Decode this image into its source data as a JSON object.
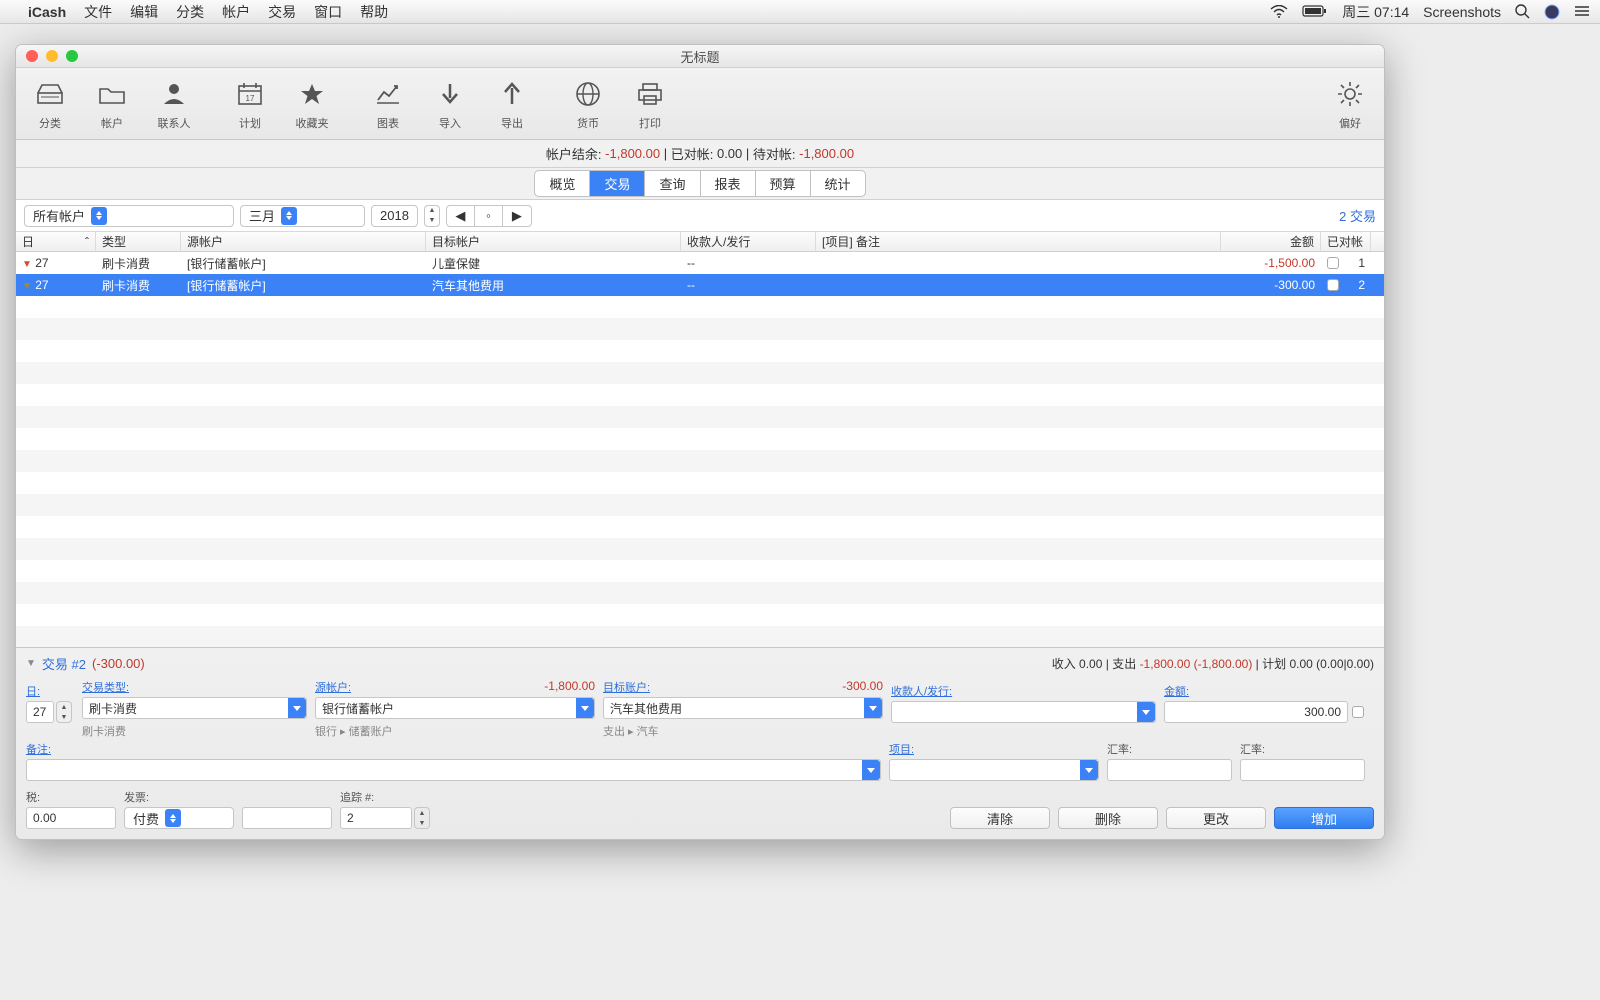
{
  "menubar": {
    "app": "iCash",
    "items": [
      "文件",
      "编辑",
      "分类",
      "帐户",
      "交易",
      "窗口",
      "帮助"
    ],
    "clock": "周三 07:14",
    "rightApp": "Screenshots"
  },
  "window": {
    "title": "无标题"
  },
  "toolbar": {
    "items": [
      "分类",
      "帐户",
      "联系人",
      "计划",
      "收藏夹",
      "图表",
      "导入",
      "导出",
      "货币",
      "打印"
    ],
    "prefs": "偏好"
  },
  "balance": {
    "balLabel": "帐户结余:",
    "balVal": "-1,800.00",
    "recLabel": "已对帐:",
    "recVal": "0.00",
    "pendLabel": "待对帐:",
    "pendVal": "-1,800.00"
  },
  "tabs": [
    "概览",
    "交易",
    "查询",
    "报表",
    "预算",
    "统计"
  ],
  "filter": {
    "account": "所有帐户",
    "month": "三月",
    "year": "2018",
    "txcount": "2 交易"
  },
  "columns": {
    "day": "日",
    "type": "类型",
    "src": "源帐户",
    "dst": "目标帐户",
    "payee": "收款人/发行",
    "proj": "[项目] 备注",
    "amt": "金额",
    "rec": "已对帐"
  },
  "rows": [
    {
      "day": "27",
      "type": "刷卡消费",
      "src": "[银行储蓄帐户]",
      "dst": "儿童保健",
      "payee": "--",
      "amt": "-1,500.00",
      "idx": "1",
      "selected": false
    },
    {
      "day": "27",
      "type": "刷卡消费",
      "src": "[银行储蓄帐户]",
      "dst": "汽车其他费用",
      "payee": "--",
      "amt": "-300.00",
      "idx": "2",
      "selected": true
    }
  ],
  "detail": {
    "header": {
      "label": "交易 #2",
      "amount": "(-300.00)",
      "summary": {
        "inLabel": "收入",
        "inVal": "0.00",
        "outLabel": "支出",
        "outVal": "-1,800.00",
        "outParen": "(-1,800.00)",
        "planLabel": "计划",
        "planVal": "0.00 (0.00|0.00)"
      }
    },
    "labels": {
      "day": "日:",
      "type": "交易类型:",
      "src": "源帐户:",
      "dst": "目标账户:",
      "payee": "收款人/发行:",
      "amount": "金额:",
      "memo": "备注:",
      "project": "项目:",
      "rate1": "汇率:",
      "rate2": "汇率:",
      "tax": "税:",
      "invoice": "发票:",
      "track": "追踪 #:"
    },
    "values": {
      "day": "27",
      "type": "刷卡消费",
      "src": "银行储蓄帐户",
      "dst": "汽车其他费用",
      "amount": "300.00",
      "srcBal": "-1,800.00",
      "dstBal": "-300.00",
      "tax": "0.00",
      "invoice": "付费",
      "track": "2"
    },
    "hints": {
      "type": "刷卡消费",
      "src": "银行 ▸ 储蓄账户",
      "dst": "支出 ▸ 汽车"
    },
    "buttons": {
      "clear": "清除",
      "delete": "删除",
      "modify": "更改",
      "add": "增加"
    }
  }
}
